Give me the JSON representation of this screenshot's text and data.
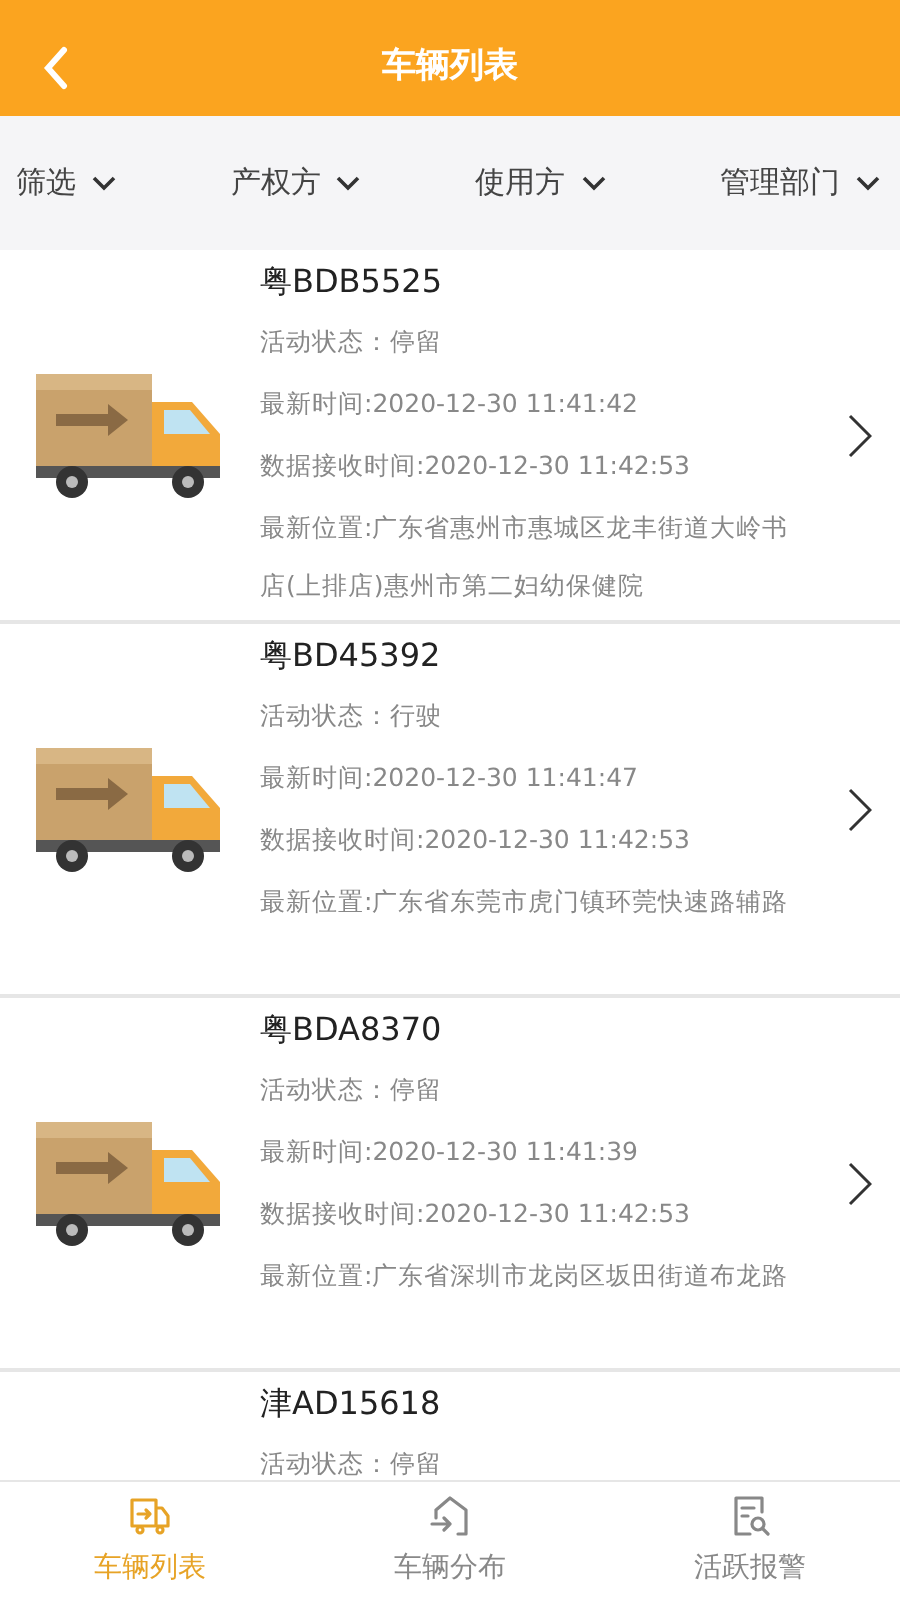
{
  "header": {
    "title": "车辆列表"
  },
  "filters": [
    {
      "label": "筛选"
    },
    {
      "label": "产权方"
    },
    {
      "label": "使用方"
    },
    {
      "label": "管理部门"
    }
  ],
  "vehicles": [
    {
      "plate": "粤BDB5525",
      "lines": [
        "活动状态：停留",
        "最新时间:2020-12-30 11:41:42",
        "数据接收时间:2020-12-30 11:42:53",
        "最新位置:广东省惠州市惠城区龙丰街道大岭书店(上排店)惠州市第二妇幼保健院"
      ]
    },
    {
      "plate": "粤BD45392",
      "lines": [
        "活动状态：行驶",
        "最新时间:2020-12-30 11:41:47",
        "数据接收时间:2020-12-30 11:42:53",
        "最新位置:广东省东莞市虎门镇环莞快速路辅路"
      ]
    },
    {
      "plate": "粤BDA8370",
      "lines": [
        "活动状态：停留",
        "最新时间:2020-12-30 11:41:39",
        "数据接收时间:2020-12-30 11:42:53",
        "最新位置:广东省深圳市龙岗区坂田街道布龙路"
      ]
    },
    {
      "plate": "津AD15618",
      "lines": [
        "活动状态：停留"
      ]
    }
  ],
  "tabs": [
    {
      "label": "车辆列表",
      "kind": "list",
      "selected": true
    },
    {
      "label": "车辆分布",
      "kind": "map",
      "selected": false
    },
    {
      "label": "活跃报警",
      "kind": "alarm",
      "selected": false
    }
  ]
}
